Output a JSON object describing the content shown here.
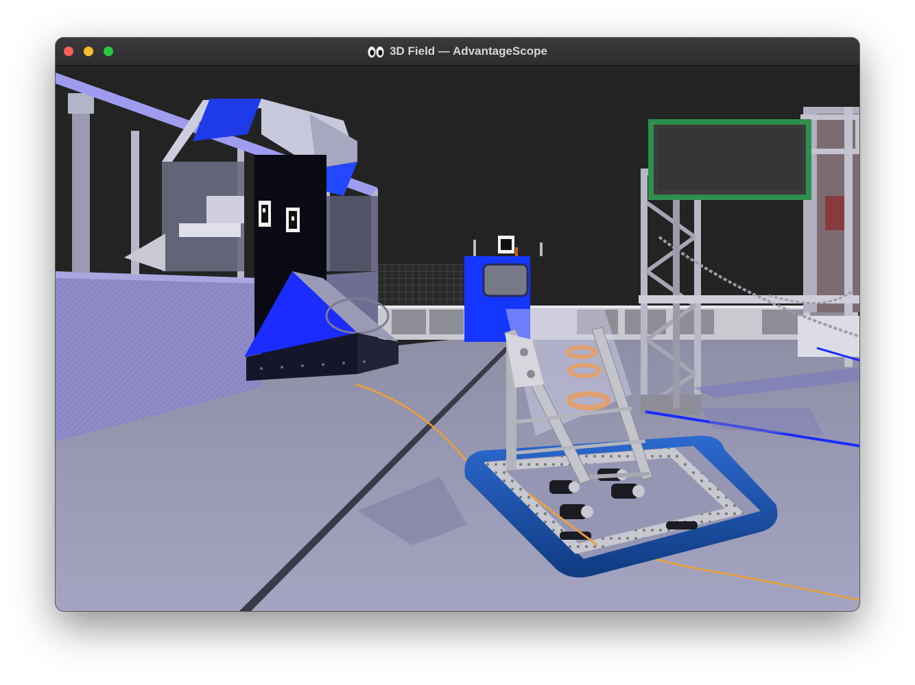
{
  "window": {
    "title": "3D Field — AdvantageScope",
    "title_icon": "eyes-icon",
    "buttons": [
      "close",
      "minimize",
      "zoom"
    ]
  },
  "scene": {
    "colors": {
      "sky": "#222222",
      "floor": "#9696b4",
      "wall": "#8a84c4",
      "alliance_blue": "#1a2cff",
      "bumper_blue": "#154a9e",
      "trajectory": "#f0a030",
      "scoreboard_frame": "#2e8a4a",
      "ring": "#e0a070"
    },
    "icons": [
      "apriltag-icon",
      "robot-icon",
      "ring-icon",
      "scoreboard-icon"
    ]
  }
}
